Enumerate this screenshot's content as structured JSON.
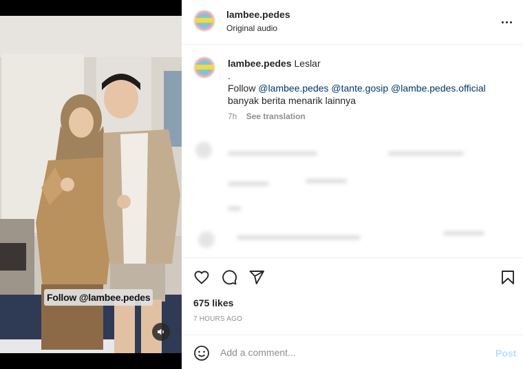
{
  "header": {
    "username": "lambee.pedes",
    "audio": "Original audio"
  },
  "media": {
    "overlay_text": "Follow @lambee.pedes",
    "sound_icon": "speaker-icon"
  },
  "caption": {
    "username": "lambee.pedes",
    "title": "Leslar",
    "dot": ".",
    "follow_word": "Follow",
    "mentions": [
      "@lambee.pedes",
      "@tante.gosip",
      "@lambe.pedes.official"
    ],
    "line3": "banyak berita menarik lainnya",
    "time": "7h",
    "see_translation": "See translation"
  },
  "actions": {
    "icons": [
      "heart-icon",
      "comment-icon",
      "share-icon",
      "bookmark-icon"
    ],
    "likes": "675 likes",
    "time_ago": "7 HOURS AGO"
  },
  "comment": {
    "placeholder": "Add a comment...",
    "post_label": "Post",
    "emoji_icon": "emoji-icon"
  },
  "colors": {
    "mention": "#00376b",
    "post_disabled": "#b2dffc",
    "muted": "#8e8e8e"
  }
}
